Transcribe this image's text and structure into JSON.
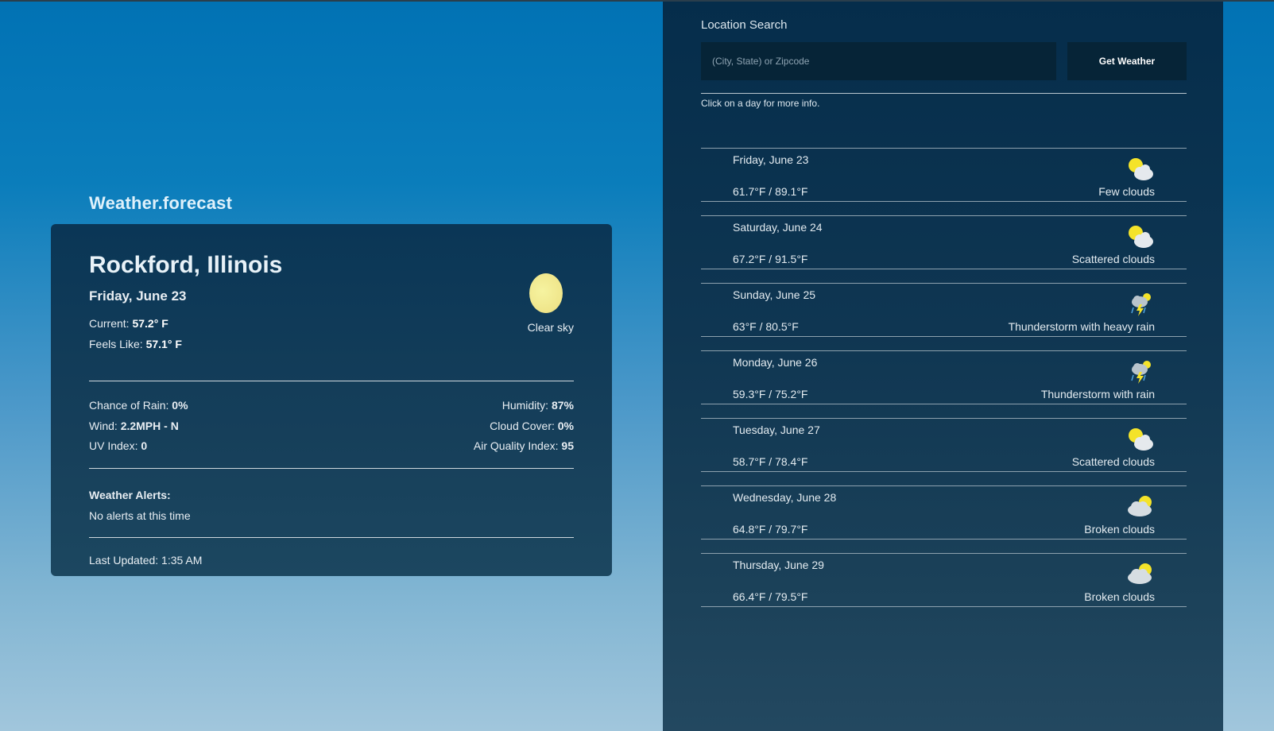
{
  "brand": "Weather.forecast",
  "current": {
    "city": "Rockford, Illinois",
    "date": "Friday, June 23",
    "current_label": "Current:",
    "current_value": "57.2° F",
    "feels_label": "Feels Like:",
    "feels_value": "57.1° F",
    "condition": "Clear sky",
    "icon": "moon-icon",
    "rain_label": "Chance of Rain:",
    "rain_value": "0%",
    "wind_label": "Wind:",
    "wind_value": "2.2MPH - N",
    "uv_label": "UV Index:",
    "uv_value": "0",
    "humidity_label": "Humidity:",
    "humidity_value": "87%",
    "cloud_label": "Cloud Cover:",
    "cloud_value": "0%",
    "aqi_label": "Air Quality Index:",
    "aqi_value": "95",
    "alerts_title": "Weather Alerts:",
    "alerts_text": "No alerts at this time",
    "updated": "Last Updated: 1:35 AM"
  },
  "search": {
    "label": "Location Search",
    "placeholder": "(City, State) or Zipcode",
    "button": "Get Weather",
    "hint": "Click on a day for more info."
  },
  "forecast": [
    {
      "day": "Friday, June 23",
      "temps": "61.7°F / 89.1°F",
      "desc": "Few clouds",
      "icon": "sun-cloud-icon"
    },
    {
      "day": "Saturday, June 24",
      "temps": "67.2°F / 91.5°F",
      "desc": "Scattered clouds",
      "icon": "sun-cloud-icon"
    },
    {
      "day": "Sunday, June 25",
      "temps": "63°F / 80.5°F",
      "desc": "Thunderstorm with heavy rain",
      "icon": "thunderstorm-icon"
    },
    {
      "day": "Monday, June 26",
      "temps": "59.3°F / 75.2°F",
      "desc": "Thunderstorm with rain",
      "icon": "thunderstorm-icon"
    },
    {
      "day": "Tuesday, June 27",
      "temps": "58.7°F / 78.4°F",
      "desc": "Scattered clouds",
      "icon": "sun-cloud-icon"
    },
    {
      "day": "Wednesday, June 28",
      "temps": "64.8°F / 79.7°F",
      "desc": "Broken clouds",
      "icon": "cloud-sun-behind-icon"
    },
    {
      "day": "Thursday, June 29",
      "temps": "66.4°F / 79.5°F",
      "desc": "Broken clouds",
      "icon": "cloud-sun-behind-icon"
    }
  ]
}
